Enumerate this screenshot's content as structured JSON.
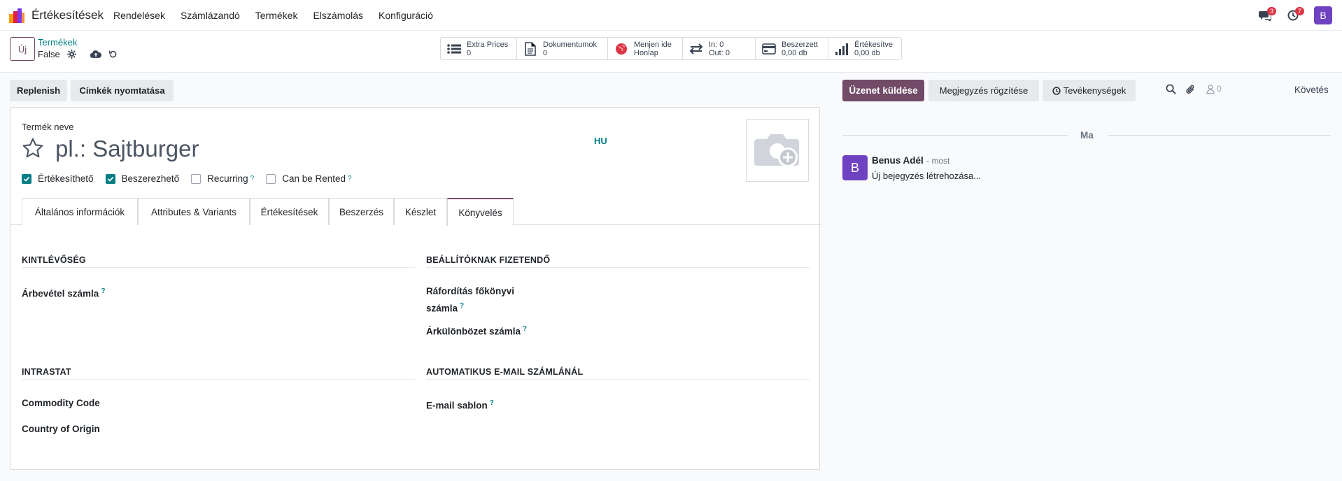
{
  "navbar": {
    "app_name": "Értékesítések",
    "menu": [
      "Rendelések",
      "Számlázandó",
      "Termékek",
      "Elszámolás",
      "Konfiguráció"
    ],
    "messages_count": "3",
    "activities_count": "7",
    "user_initial": "B",
    "colors": {
      "badge": "#dc3545",
      "avatar": "#6f42c1"
    }
  },
  "control_panel": {
    "new_label": "Új",
    "breadcrumb_parent": "Termékek",
    "record_name": "False",
    "stats": [
      {
        "icon": "list-icon",
        "line1": "Extra Prices",
        "line2": "0"
      },
      {
        "icon": "document-icon",
        "line1": "Dokumentumok",
        "line2": "0"
      },
      {
        "icon": "globe-icon",
        "line1": "Menjen ide",
        "line2": "Honlap"
      },
      {
        "icon": "exchange-icon",
        "line1": "In: 0",
        "line2": "Out: 0"
      },
      {
        "icon": "credit-card-icon",
        "line1": "Beszerzett",
        "line2": "0,00 db"
      },
      {
        "icon": "bar-chart-icon",
        "line1": "Értékesítve",
        "line2": "0,00 db"
      }
    ]
  },
  "actions": {
    "replenish": "Replenish",
    "print_labels": "Címkék nyomtatása"
  },
  "form": {
    "product_name_label": "Termék neve",
    "product_name_placeholder": "pl.: Sajtburger",
    "lang": "HU",
    "checkboxes": [
      {
        "label": "Értékesíthető",
        "checked": true,
        "help": ""
      },
      {
        "label": "Beszerezhető",
        "checked": true,
        "help": ""
      },
      {
        "label": "Recurring",
        "checked": false,
        "help": "?"
      },
      {
        "label": "Can be Rented",
        "checked": false,
        "help": "?"
      }
    ],
    "tabs": [
      "Általános információk",
      "Attributes & Variants",
      "Értékesítések",
      "Beszerzés",
      "Készlet",
      "Könyvelés"
    ],
    "active_tab": "Könyvelés",
    "sections": {
      "receivable_title": "KINTLÉVŐSÉG",
      "income_account": "Árbevétel számla",
      "payable_title": "BEÁLLÍTÓKNAK FIZETENDŐ",
      "expense_account_1": "Ráfordítás főkönyvi",
      "expense_account_2": "számla",
      "price_diff_account": "Árkülönbözet számla",
      "intrastat_title": "INTRASTAT",
      "commodity_code": "Commodity Code",
      "country_origin": "Country of Origin",
      "auto_email_title": "AUTOMATIKUS E-MAIL SZÁMLÁNÁL",
      "email_template": "E-mail sablon",
      "help": "?"
    }
  },
  "chatter": {
    "send_message": "Üzenet küldése",
    "log_note": "Megjegyzés rögzítése",
    "activities": "Tevékenységek",
    "followers_count": "0",
    "follow": "Követés",
    "day": "Ma",
    "message": {
      "author_initial": "B",
      "author": "Benus Adél",
      "time": "- most",
      "body": "Új bejegyzés létrehozása..."
    },
    "colors": {
      "primary": "#714b67"
    }
  }
}
